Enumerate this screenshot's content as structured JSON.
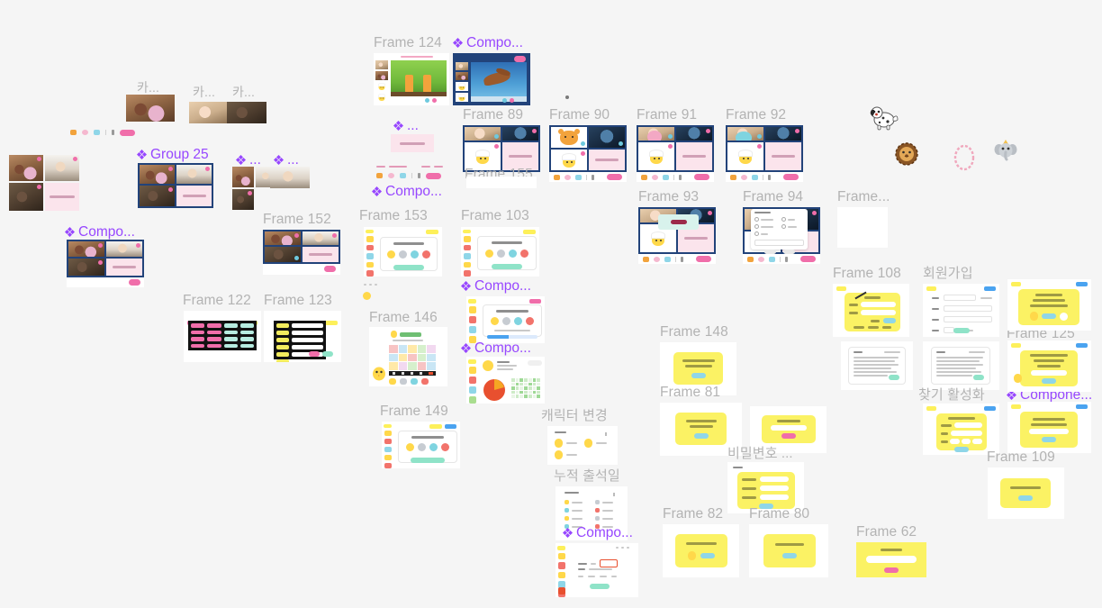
{
  "app": {
    "name": "figma-canvas",
    "background_color": "#f5f5f5",
    "frame_label_color": "#b3b3b3",
    "component_label_color": "#9747ff",
    "selection_color": "#0d99ff"
  },
  "labels": {
    "frame_124": "Frame 124",
    "component_top_1": "Compo...",
    "frame_89": "Frame 89",
    "frame_90": "Frame 90",
    "frame_91": "Frame 91",
    "frame_92": "Frame 92",
    "frame_155": "Frame 155",
    "frame_93": "Frame 93",
    "frame_94": "Frame 94",
    "frame_short": "Frame...",
    "ka_1": "카...",
    "ka_2": "카...",
    "ka_3": "카...",
    "group_25": "Group 25",
    "comp_dots_1": "...",
    "comp_dots_2": "...",
    "comp_dots_3": "...",
    "component_left": "Compo...",
    "frame_152": "Frame 152",
    "frame_122": "Frame 122",
    "frame_123": "Frame 123",
    "frame_153": "Frame 153",
    "frame_103": "Frame 103",
    "component_mid_1": "Compo...",
    "component_mid_2": "Compo...",
    "component_mid_3": "Comp...",
    "frame_146": "Frame 146",
    "frame_149": "Frame 149",
    "character_change": "캐릭터 변경",
    "cumulative_attendance": "누적 출석일",
    "component_bottom": "Compo...",
    "frame_148": "Frame 148",
    "frame_81": "Frame 81",
    "password_label": "비밀변호 ...",
    "frame_82": "Frame 82",
    "frame_80": "Frame 80",
    "frame_62": "Frame 62",
    "frame_108": "Frame 108",
    "signup": "회원가입",
    "frame_125": "Frame 125",
    "find_activate": "찾기 활성화",
    "component_right": "Compone...",
    "frame_109": "Frame 109"
  },
  "icons": {
    "component_diamond": "component-diamond-icon",
    "mic": "mic-icon",
    "camera": "camera-icon",
    "share": "share-screen-icon",
    "participants": "participants-icon",
    "leave": "leave-button"
  },
  "animals": {
    "dog": "dalmatian-dog-illustration",
    "lion": "lion-head-illustration",
    "hoop": "ring-hoop-illustration",
    "elephant": "elephant-illustration"
  }
}
